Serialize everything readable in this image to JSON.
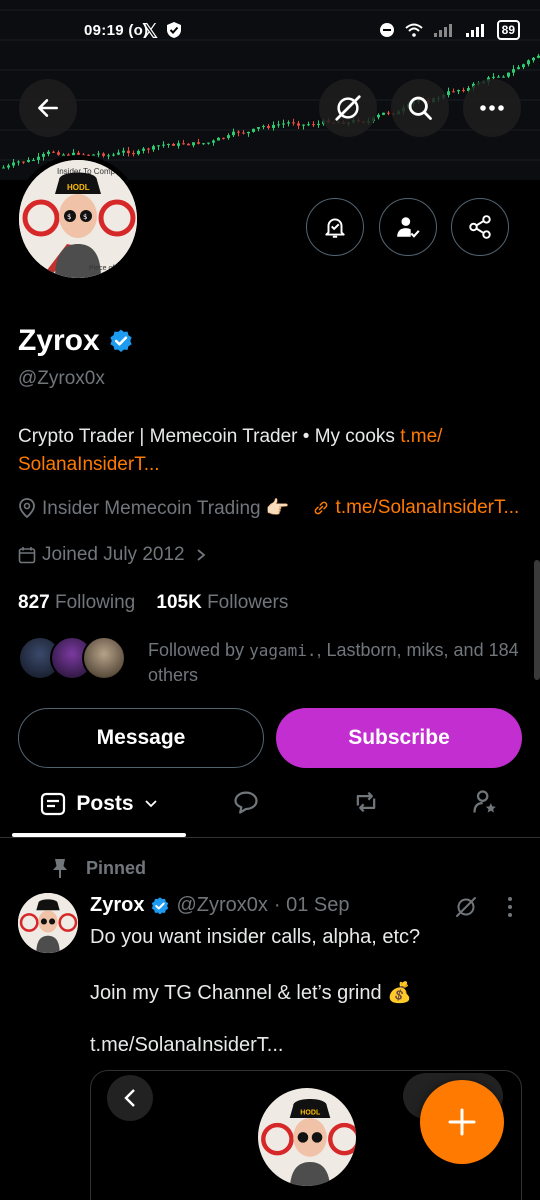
{
  "status_bar": {
    "time": "09:19",
    "extra": "(o)",
    "battery": "89"
  },
  "profile": {
    "display_name": "Zyrox",
    "handle": "@Zyrox0x",
    "bio_text": "Crypto Trader | Memecoin Trader • My cooks ",
    "bio_link_line1": "t.me/",
    "bio_link_line2": "SolanaInsiderT...",
    "location": "Insider Memecoin Trading 👉🏻",
    "website": "t.me/SolanaInsiderT...",
    "joined": "Joined July 2012",
    "following_count": "827",
    "following_label": "Following",
    "followers_count": "105K",
    "followers_label": "Followers",
    "followed_by_text_prefix": "Followed by ",
    "followed_by_name1": "yagami.",
    "followed_by_rest": ", Lastborn, miks, and 184 others",
    "verified_color": "#1d9bf0",
    "link_color": "#ff7a00"
  },
  "actions": {
    "message_label": "Message",
    "subscribe_label": "Subscribe",
    "subscribe_color": "#c22ed0"
  },
  "tabs": {
    "posts_label": "Posts"
  },
  "post": {
    "pinned_label": "Pinned",
    "author_name": "Zyrox",
    "author_handle": "@Zyrox0x",
    "date": "· 01 Sep",
    "line1": "Do you want insider calls, alpha, etc?",
    "line2": "Join my TG Channel & let’s grind 💰",
    "link": "t.me/SolanaInsiderT..."
  },
  "avatar_text": {
    "cap_label": "HODL",
    "sign_top": "Insider To Comp",
    "sign_bottom": "Piece of Me"
  },
  "fab": {
    "icon": "plus-icon",
    "color": "#ff7a00"
  }
}
